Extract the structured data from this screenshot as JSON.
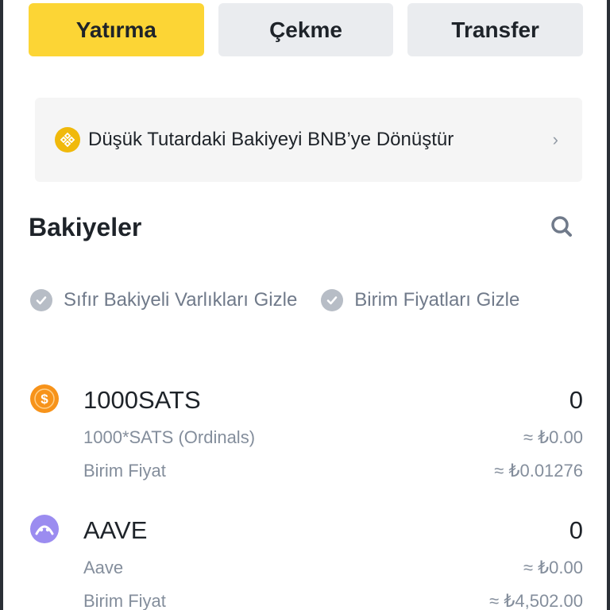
{
  "tabs": [
    {
      "label": "Yatırma"
    },
    {
      "label": "Çekme"
    },
    {
      "label": "Transfer"
    }
  ],
  "banner": {
    "text": "Düşük Tutardaki Bakiyeyi BNB’ye Dönüştür",
    "icon": "bnb-icon",
    "chevron": "›"
  },
  "balances": {
    "title": "Bakiyeler",
    "filters": [
      {
        "label": "Sıfır Bakiyeli Varlıkları Gizle"
      },
      {
        "label": "Birim Fiyatları Gizle"
      }
    ]
  },
  "assets": [
    {
      "symbol": "1000SATS",
      "name": "1000*SATS (Ordinals)",
      "unit_price_label": "Birim Fiyat",
      "amount": "0",
      "value": "≈ ₺0.00",
      "unit_price": "≈ ₺0.01276",
      "icon": "sats-coin-icon",
      "icon_color": "#f7931a"
    },
    {
      "symbol": "AAVE",
      "name": "Aave",
      "unit_price_label": "Birim Fiyat",
      "amount": "0",
      "value": "≈ ₺0.00",
      "unit_price": "≈ ₺4,502.00",
      "icon": "aave-coin-icon",
      "icon_color": "#9b8cf0"
    }
  ],
  "colors": {
    "primary": "#fcd535",
    "secondary_button": "#eaecef",
    "muted_text": "#848e9c"
  }
}
